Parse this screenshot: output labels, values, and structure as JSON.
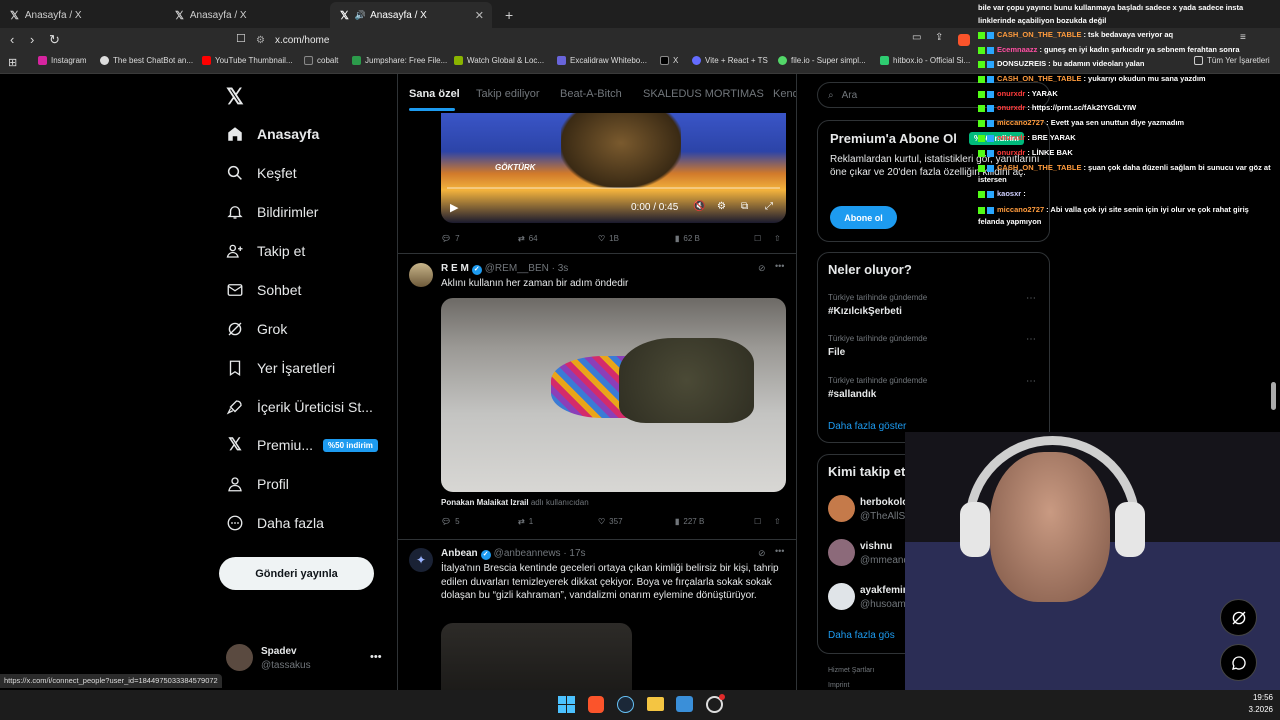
{
  "browser": {
    "tabs": [
      {
        "title": "Anasayfa / X"
      },
      {
        "title": "Anasayfa / X"
      },
      {
        "title": "Anasayfa / X"
      }
    ],
    "url": "x.com/home",
    "bookmarks": [
      "Instagram",
      "The best ChatBot an...",
      "YouTube Thumbnail...",
      "cobalt",
      "Jumpshare: Free File...",
      "Watch Global & Loc...",
      "Excalidraw Whitebo...",
      "X",
      "Vite + React + TS",
      "file.io - Super simpl...",
      "hitbox.io - Official Si...",
      "Tüm Yer İşaretleri"
    ]
  },
  "nav": {
    "items": [
      {
        "label": "Anasayfa"
      },
      {
        "label": "Keşfet"
      },
      {
        "label": "Bildirimler"
      },
      {
        "label": "Takip et"
      },
      {
        "label": "Sohbet"
      },
      {
        "label": "Grok"
      },
      {
        "label": "Yer İşaretleri"
      },
      {
        "label": "İçerik Üreticisi St..."
      },
      {
        "label": "Premiu..."
      },
      {
        "label": "Profil"
      },
      {
        "label": "Daha fazla"
      }
    ],
    "premium_badge": "%50 indirim",
    "post_button": "Gönderi yayınla",
    "account": {
      "name": "Spadev",
      "handle": "@tassakus"
    }
  },
  "feed": {
    "tabs": [
      "Sana özel",
      "Takip ediliyor",
      "Beat-A-Bitch",
      "SKALEDUS MORTIMAS",
      "Kend"
    ],
    "video": {
      "caption": "GÖKTÜRK",
      "time": "0:00 / 0:45"
    },
    "tweet0_actions": {
      "replies": "7",
      "reposts": "64",
      "likes": "1B",
      "views": "62 B"
    },
    "tweet1": {
      "name": "R E M",
      "handle": "@REM__BEN · 3s",
      "text": "Aklını kullanın her zaman bir adım öndedir",
      "tag_name": "Ponakan Malaikat Izrail",
      "tag_suffix": "adlı kullanıcıdan",
      "actions": {
        "replies": "5",
        "reposts": "1",
        "likes": "357",
        "views": "227 B"
      }
    },
    "tweet2": {
      "name": "Anbean",
      "handle": "@anbeannews · 17s",
      "text": "İtalya'nın Brescia kentinde geceleri ortaya çıkan kimliği belirsiz bir kişi, tahrip edilen duvarları temizleyerek dikkat çekiyor. Boya ve fırçalarla sokak sokak dolaşan bu “gizli kahraman”, vandalizmi onarım eylemine dönüştürüyor."
    }
  },
  "right": {
    "search_placeholder": "Ara",
    "premium": {
      "title": "Premium'a Abone Ol",
      "body": "Reklamlardan kurtul, istatistikleri gör, yanıtlarını öne çıkar ve 20'den fazla özelliğin kilidini aç.",
      "button": "Abone ol",
      "badge": "%50 indirim"
    },
    "trends_title": "Neler oluyor?",
    "trends": [
      {
        "meta": "Türkiye tarihinde gündemde",
        "name": "#KızılcıkŞerbeti"
      },
      {
        "meta": "Türkiye tarihinde gündemde",
        "name": "File"
      },
      {
        "meta": "Türkiye tarihinde gündemde",
        "name": "#sallandık"
      }
    ],
    "show_more": "Daha fazla göster",
    "who_title": "Kimi takip etmeli",
    "who": [
      {
        "name": "herbokolog",
        "handle": "@TheAllShitologg"
      },
      {
        "name": "vishnu",
        "handle": "@mmeandther"
      },
      {
        "name": "ayakfemini",
        "handle": "@husoama"
      }
    ],
    "who_more": "Daha fazla gös",
    "footer": "Hizmet Şartları",
    "footer2": "Imprint"
  },
  "status_url": "https://x.com/i/connect_people?user_id=1844975033384579072",
  "chat": [
    {
      "user": "",
      "msg": "bile var çopu yayıncı bunu kullanmaya başladı sadece x yada sadece insta"
    },
    {
      "user": "",
      "msg": "linklerinde açabiliyon bozukda değil"
    },
    {
      "user": "CASH_ON_THE_TABLE",
      "color": "#ff9b3d",
      "msg": ": tsk bedavaya veriyor aq"
    },
    {
      "user": "Ecemnaazz",
      "color": "#ff4fa3",
      "msg": ": guneş en iyi kadın şarkıcıdır ya sebnem ferahtan sonra"
    },
    {
      "user": "DONSUZREIS",
      "color": "#ffffff",
      "msg": ": bu adamın videoları yalan"
    },
    {
      "user": "CASH_ON_THE_TABLE",
      "color": "#ff9b3d",
      "msg": ": yukarıyı okudun mu sana yazdım"
    },
    {
      "user": "onurxdr",
      "color": "#ff3b3b",
      "msg": ": YARAK"
    },
    {
      "user": "onurxdr",
      "color": "#ff3b3b",
      "msg": ": https://prnt.sc/fAk2tYGdLYIW"
    },
    {
      "user": "miccano2727",
      "color": "#ff9b3d",
      "msg": ": Evett yaa sen unuttun diye yazmadım"
    },
    {
      "user": "onurxdr",
      "color": "#ff3b3b",
      "msg": ": BRE YARAK"
    },
    {
      "user": "onurxdr",
      "color": "#ff3b3b",
      "msg": ": LİNKE BAK"
    },
    {
      "user": "CASH_ON_THE_TABLE",
      "color": "#ff9b3d",
      "msg": ": şuan çok daha düzenli sağlam bi sunucu var göz at"
    },
    {
      "user": "",
      "msg": "istersen"
    },
    {
      "user": "kaosxr",
      "color": "#d0d0ff",
      "msg": ":"
    },
    {
      "user": "miccano2727",
      "color": "#ff9b3d",
      "msg": ": Abi valla çok iyi site senin için iyi olur ve çok rahat giriş"
    },
    {
      "user": "",
      "msg": "felanda yapmıyon"
    }
  ],
  "taskbar": {
    "time": "19:56",
    "date": "3.2026"
  }
}
